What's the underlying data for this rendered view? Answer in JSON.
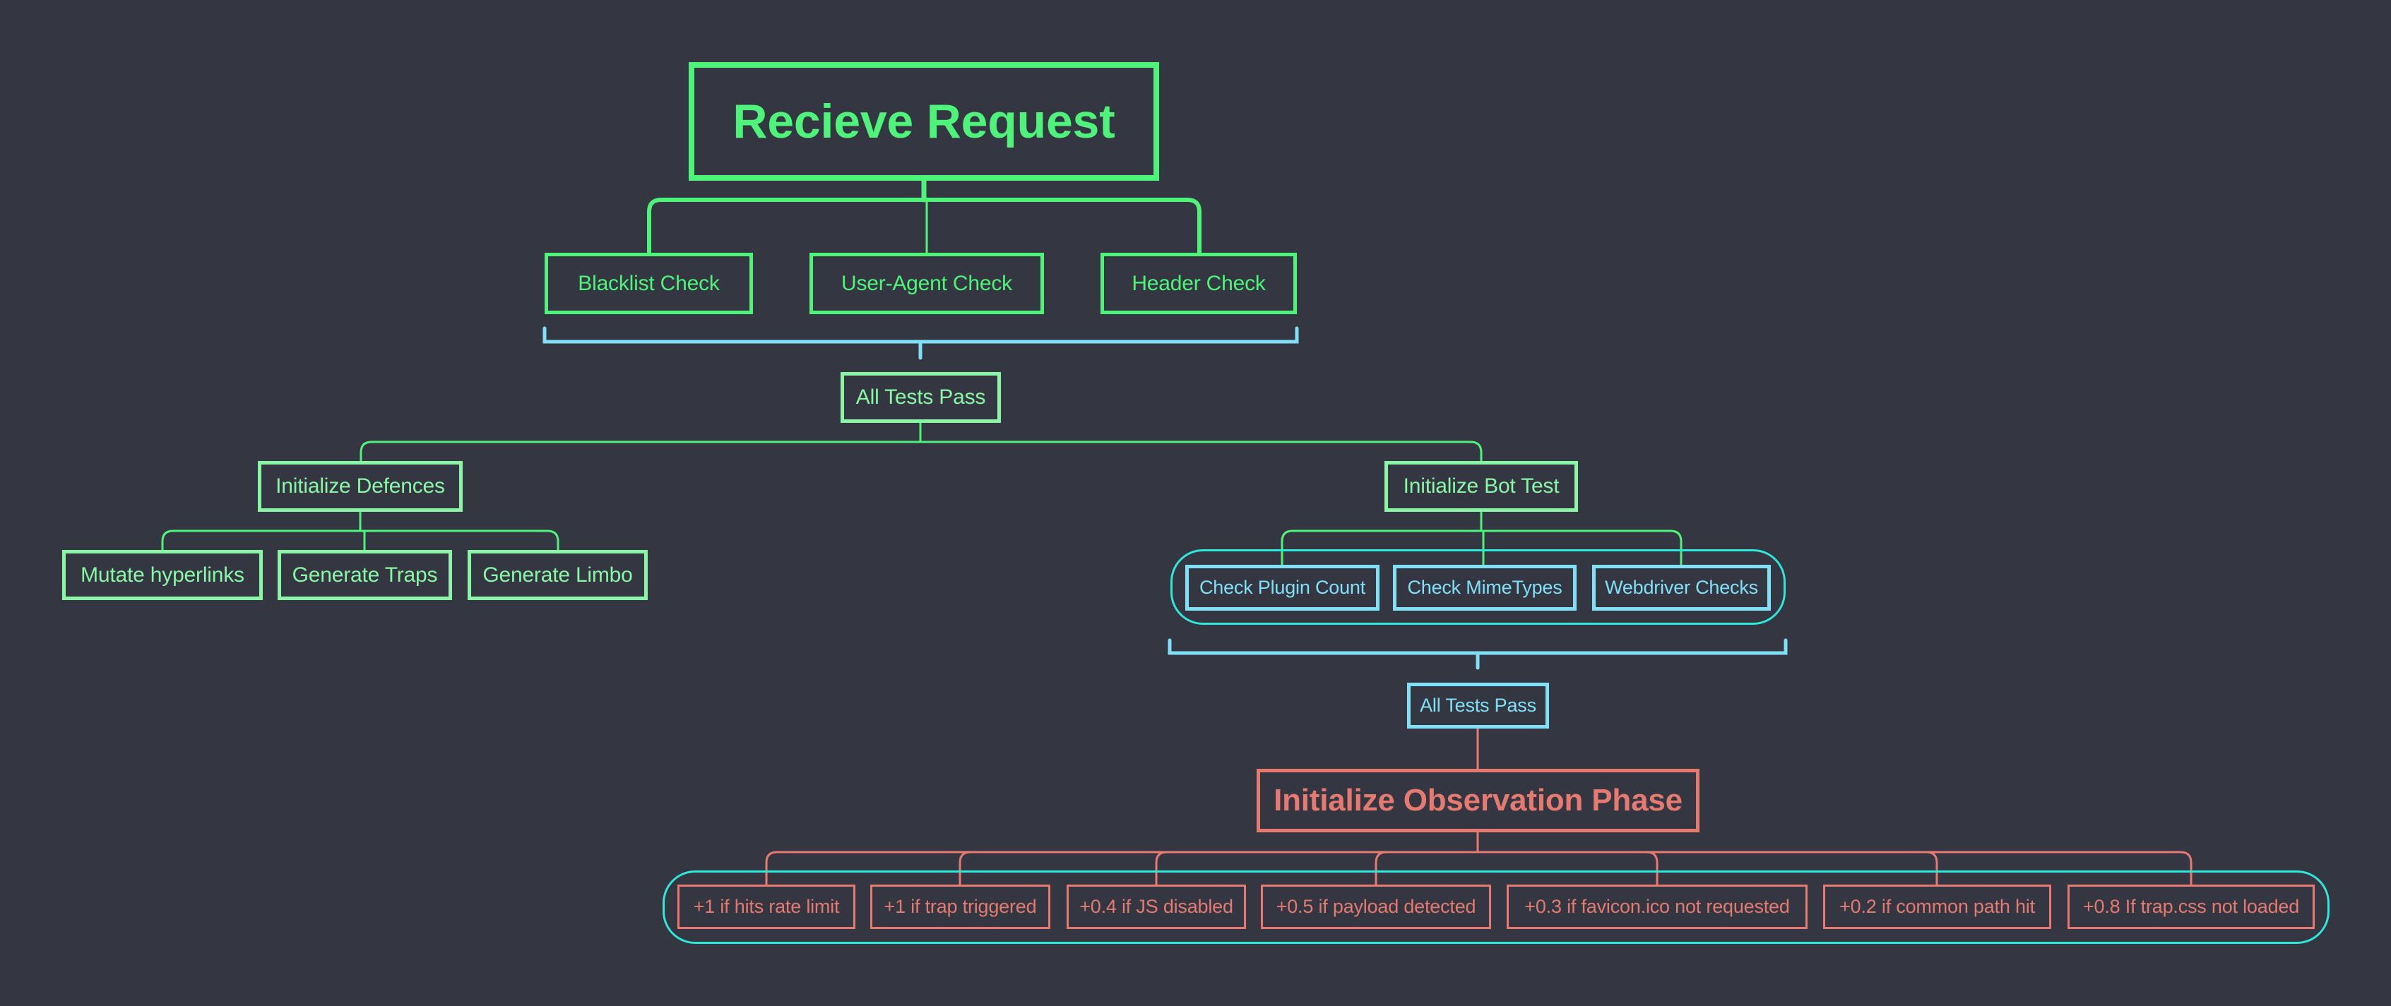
{
  "colors": {
    "background": "#343642",
    "green_primary": "#4ef47a",
    "green_light": "#8af5a5",
    "blue": "#7fe0f6",
    "teal_group": "#2ee8d8",
    "red": "#e47a70"
  },
  "root": {
    "label": "Recieve Request"
  },
  "initial_checks": [
    {
      "label": "Blacklist Check"
    },
    {
      "label": "User-Agent Check"
    },
    {
      "label": "Header Check"
    }
  ],
  "gate_1": {
    "label": "All Tests Pass"
  },
  "defences": {
    "label": "Initialize Defences",
    "children": [
      {
        "label": "Mutate hyperlinks"
      },
      {
        "label": "Generate Traps"
      },
      {
        "label": "Generate Limbo"
      }
    ]
  },
  "bot_test": {
    "label": "Initialize Bot Test",
    "children": [
      {
        "label": "Check Plugin Count"
      },
      {
        "label": "Check MimeTypes"
      },
      {
        "label": "Webdriver Checks"
      }
    ]
  },
  "gate_2": {
    "label": "All Tests Pass"
  },
  "observation": {
    "label": "Initialize Observation Phase",
    "rules": [
      {
        "label": "+1 if hits rate limit"
      },
      {
        "label": "+1 if trap triggered"
      },
      {
        "label": "+0.4 if JS disabled"
      },
      {
        "label": "+0.5 if payload detected"
      },
      {
        "label": "+0.3 if favicon.ico not requested"
      },
      {
        "label": "+0.2 if common path hit"
      },
      {
        "label": "+0.8 If trap.css not loaded"
      }
    ]
  }
}
